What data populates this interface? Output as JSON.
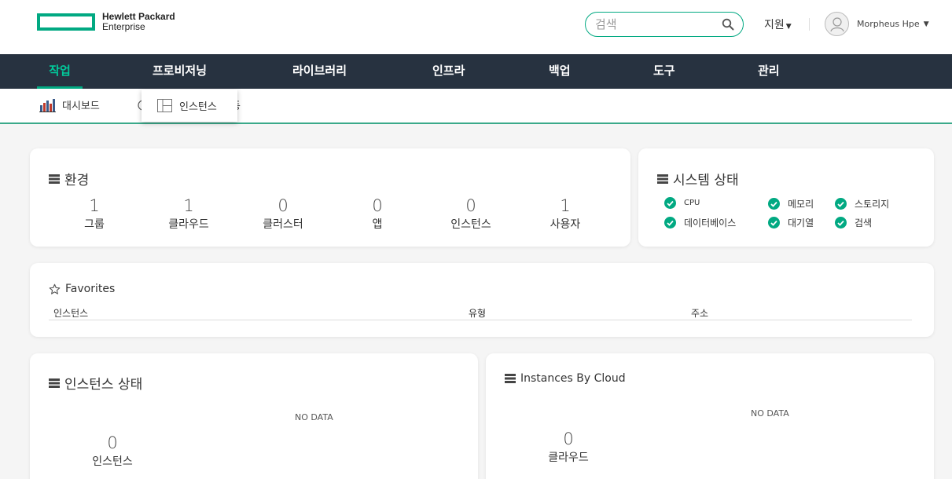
{
  "header": {
    "logo_line1": "Hewlett Packard",
    "logo_line2": "Enterprise",
    "search_placeholder": "검색",
    "support_label": "지원",
    "user_name": "Morpheus Hpe"
  },
  "nav": {
    "items": [
      "작업",
      "프로비저닝",
      "라이브러리",
      "인프라",
      "백업",
      "도구",
      "관리"
    ],
    "active": "작업"
  },
  "subnav": {
    "dashboard_label": "대시보드",
    "activity_label_partial": "활동"
  },
  "dropdown": {
    "instances_label": "인스턴스"
  },
  "environment": {
    "title": "환경",
    "stats": [
      {
        "value": "1",
        "label": "그룹"
      },
      {
        "value": "1",
        "label": "클라우드"
      },
      {
        "value": "0",
        "label": "클러스터"
      },
      {
        "value": "0",
        "label": "앱"
      },
      {
        "value": "0",
        "label": "인스턴스"
      },
      {
        "value": "1",
        "label": "사용자"
      }
    ]
  },
  "system_status": {
    "title": "시스템 상태",
    "items": [
      "CPU",
      "메모리",
      "스토리지",
      "데이터베이스",
      "대기열",
      "검색"
    ],
    "status_color": "#01a982"
  },
  "favorites": {
    "title": "Favorites",
    "columns": [
      "인스턴스",
      "유형",
      "주소"
    ]
  },
  "instance_status": {
    "title": "인스턴스 상태",
    "no_data": "NO DATA",
    "count": "0",
    "count_label": "인스턴스"
  },
  "instances_by_cloud": {
    "title": "Instances By Cloud",
    "no_data": "NO DATA",
    "count": "0",
    "count_label": "클라우드"
  },
  "colors": {
    "accent": "#01a982",
    "navbar": "#273240",
    "background": "#f5f5f5"
  }
}
